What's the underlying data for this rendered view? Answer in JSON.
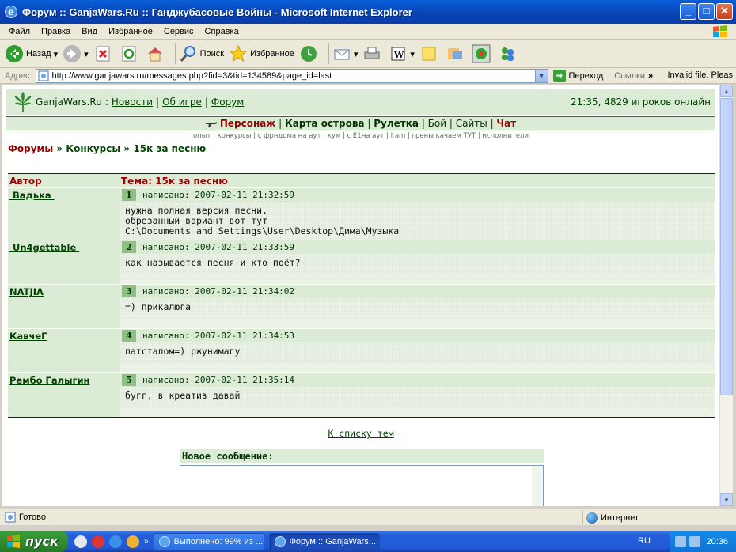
{
  "window": {
    "title": "Форум :: GanjaWars.Ru :: Ганджубасовые Войны - Microsoft Internet Explorer"
  },
  "menu": [
    "Файл",
    "Правка",
    "Вид",
    "Избранное",
    "Сервис",
    "Справка"
  ],
  "toolbar": {
    "back": "Назад",
    "search": "Поиск",
    "favorites": "Избранное"
  },
  "address": {
    "label": "Адрес:",
    "url": "http://www.ganjawars.ru/messages.php?fid=3&tid=134589&page_id=last",
    "go": "Переход",
    "links": "Ссылки",
    "invalid": "Invalid file. Pleas"
  },
  "site": {
    "brand": "GanjaWars.Ru",
    "colon": ":",
    "nav_top": [
      "Новости",
      "Об игре",
      "Форум"
    ],
    "online": "21:35, 4829 игроков онлайн",
    "nav_main": [
      "Персонаж",
      "Карта острова",
      "Рулетка",
      "Бой",
      "Сайты",
      "Чат"
    ],
    "sub_links": "опыт | конкурсы | с фрндома на аут | кум | с Е1на аут | I am | грены качаем ТУТ | исполнители",
    "crumbs": {
      "forums": "Форумы",
      "sep": "»",
      "section": "Конкурсы",
      "topic": "15к за песню"
    }
  },
  "thread": {
    "col_author": "Автор",
    "col_topic": "Тема: 15к за песню",
    "posts": [
      {
        "author": " Вадька ",
        "num": "1",
        "meta": "написано: 2007-02-11 21:32:59",
        "lines": [
          "нужна полная версия песни.",
          "обрезанный вариант вот тут",
          "C:\\Documents and Settings\\User\\Desktop\\Дима\\Музыка"
        ]
      },
      {
        "author": " Un4gettable ",
        "num": "2",
        "meta": "написано: 2007-02-11 21:33:59",
        "lines": [
          "как называется песня и кто поёт?"
        ]
      },
      {
        "author": "NATJIA",
        "num": "3",
        "meta": "написано: 2007-02-11 21:34:02",
        "lines": [
          "=) прикалюга"
        ]
      },
      {
        "author": "КавчеГ",
        "num": "4",
        "meta": "написано: 2007-02-11 21:34:53",
        "lines": [
          "патсталом=) ржунимагу"
        ]
      },
      {
        "author": "Рембо Галыгин",
        "num": "5",
        "meta": "написано: 2007-02-11 21:35:14",
        "lines": [
          "бугг, в креатив давай"
        ]
      }
    ],
    "to_list": "К списку тем",
    "new_message": "Новое сообщение:"
  },
  "status": {
    "text": "Готово",
    "zone": "Интернет"
  },
  "taskbar": {
    "start": "пуск",
    "tasks": [
      "Выполнено: 99% из ...",
      "Форум :: GanjaWars...."
    ],
    "lang": "RU",
    "clock": "20:36"
  }
}
